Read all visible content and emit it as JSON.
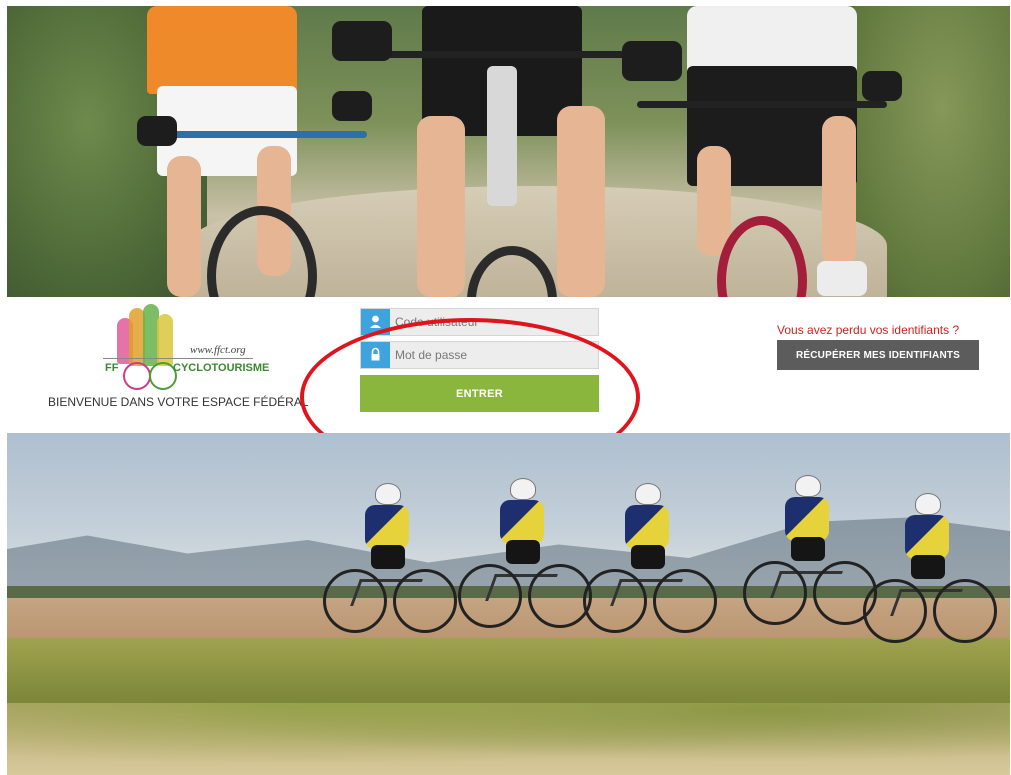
{
  "brand": {
    "logo_url_text": "www.ffct.org",
    "logo_ff": "FF",
    "logo_cyclotourisme": "CYCLOTOURISME",
    "welcome_text": "BIENVENUE DANS VOTRE ESPACE FÉDÉRAL !"
  },
  "login": {
    "username_placeholder": "Code utilisateur",
    "password_placeholder": "Mot de passe",
    "submit_label": "ENTRER"
  },
  "recovery": {
    "lost_text": "Vous avez perdu vos identifiants ?",
    "button_label": "RÉCUPÉRER MES IDENTIFIANTS"
  },
  "colors": {
    "input_icon_bg": "#3fa3de",
    "enter_button": "#8bb63d",
    "recover_button": "#5c5c5c",
    "lost_text": "#d21f1f",
    "annotation_circle": "#e0141b"
  },
  "icons": {
    "username": "user-icon",
    "password": "lock-icon"
  }
}
